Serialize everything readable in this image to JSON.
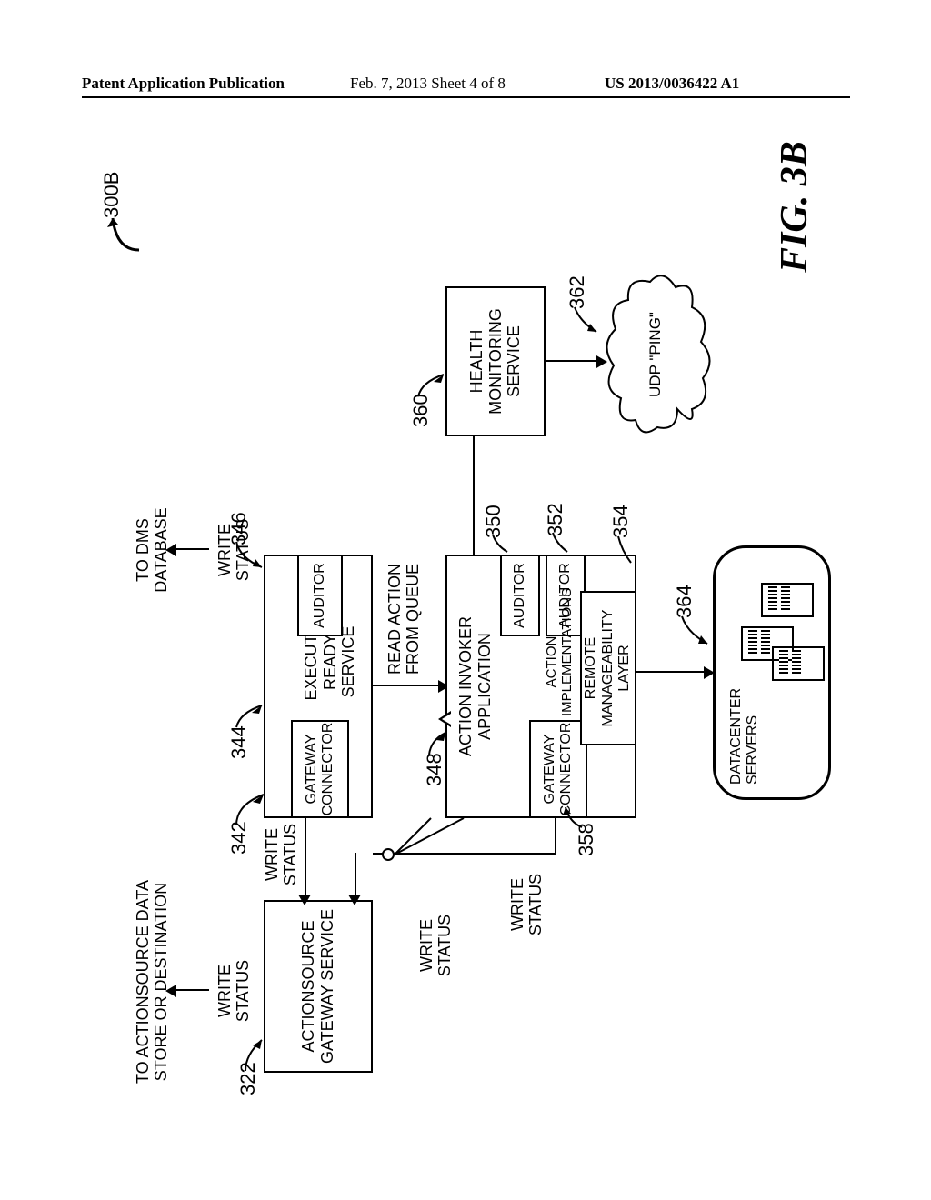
{
  "header": {
    "left": "Patent Application Publication",
    "center": "Feb. 7, 2013  Sheet 4 of 8",
    "right": "US 2013/0036422 A1"
  },
  "figure": {
    "caption": "FIG. 3B",
    "top_ref": "300B"
  },
  "refs": {
    "r322": "322",
    "r342": "342",
    "r344": "344",
    "r346": "346",
    "r348": "348",
    "r350": "350",
    "r352": "352",
    "r354": "354",
    "r358": "358",
    "r360": "360",
    "r362": "362",
    "r364": "364"
  },
  "labels": {
    "to_actionsource": "TO ACTIONSOURCE DATA\nSTORE OR DESTINATION",
    "to_dms": "TO DMS\nDATABASE",
    "write_status": "WRITE\nSTATUS",
    "read_action": "READ ACTION\nFROM QUEUE",
    "datacenter_servers": "DATACENTER\nSERVERS"
  },
  "boxes": {
    "actionsource_gateway": "ACTIONSOURCE\nGATEWAY SERVICE",
    "execute_ready": "EXECUTE READY\nSERVICE",
    "gateway_connector": "GATEWAY\nCONNECTOR",
    "auditor": "AUDITOR",
    "action_invoker": "ACTION INVOKER\nAPPLICATION",
    "action_impl": "ACTION\nIMPLEMENTATIONS",
    "remote_layer": "REMOTE\nMANAGEABILITY\nLAYER",
    "health_monitor": "HEALTH\nMONITORING\nSERVICE",
    "udp_ping": "UDP \"PING\""
  },
  "chart_data": {
    "type": "diagram",
    "title": "FIG. 3B",
    "figure_id": "300B",
    "nodes": [
      {
        "id": 322,
        "label": "ACTIONSOURCE GATEWAY SERVICE"
      },
      {
        "id": 342,
        "label": "GATEWAY CONNECTOR"
      },
      {
        "id": 344,
        "label": "EXECUTE READY SERVICE"
      },
      {
        "id": 346,
        "label": "AUDITOR"
      },
      {
        "id": 348,
        "label": "ACTION INVOKER APPLICATION"
      },
      {
        "id": 350,
        "label": "AUDITOR"
      },
      {
        "id": 352,
        "label": "AUDITOR"
      },
      {
        "id": 354,
        "label": "REMOTE MANAGEABILITY LAYER"
      },
      {
        "id": 358,
        "label": "GATEWAY CONNECTOR"
      },
      {
        "id": 360,
        "label": "HEALTH MONITORING SERVICE"
      },
      {
        "id": 362,
        "label": "UDP \"PING\""
      },
      {
        "id": 364,
        "label": "DATACENTER SERVERS"
      }
    ],
    "edges": [
      {
        "from": 322,
        "to": null,
        "label": "WRITE STATUS",
        "note": "TO ACTIONSOURCE DATA STORE OR DESTINATION"
      },
      {
        "from": 342,
        "to": 322,
        "label": "WRITE STATUS"
      },
      {
        "from": 344,
        "to": 342,
        "label": ""
      },
      {
        "from": 344,
        "to": 346,
        "label": ""
      },
      {
        "from": 346,
        "to": null,
        "label": "WRITE STATUS",
        "note": "TO DMS DATABASE"
      },
      {
        "from": 344,
        "to": 348,
        "label": "READ ACTION FROM QUEUE"
      },
      {
        "from": 348,
        "to": 350,
        "label": ""
      },
      {
        "from": 348,
        "to": 352,
        "label": ""
      },
      {
        "from": 348,
        "to": 358,
        "label": ""
      },
      {
        "from": 358,
        "to": 322,
        "label": "WRITE STATUS"
      },
      {
        "from": 354,
        "to": 348,
        "label": "",
        "note": "ACTION IMPLEMENTATIONS"
      },
      {
        "from": 354,
        "to": 364,
        "label": ""
      },
      {
        "from": 360,
        "to": 348,
        "label": ""
      },
      {
        "from": 360,
        "to": 362,
        "label": ""
      }
    ]
  }
}
